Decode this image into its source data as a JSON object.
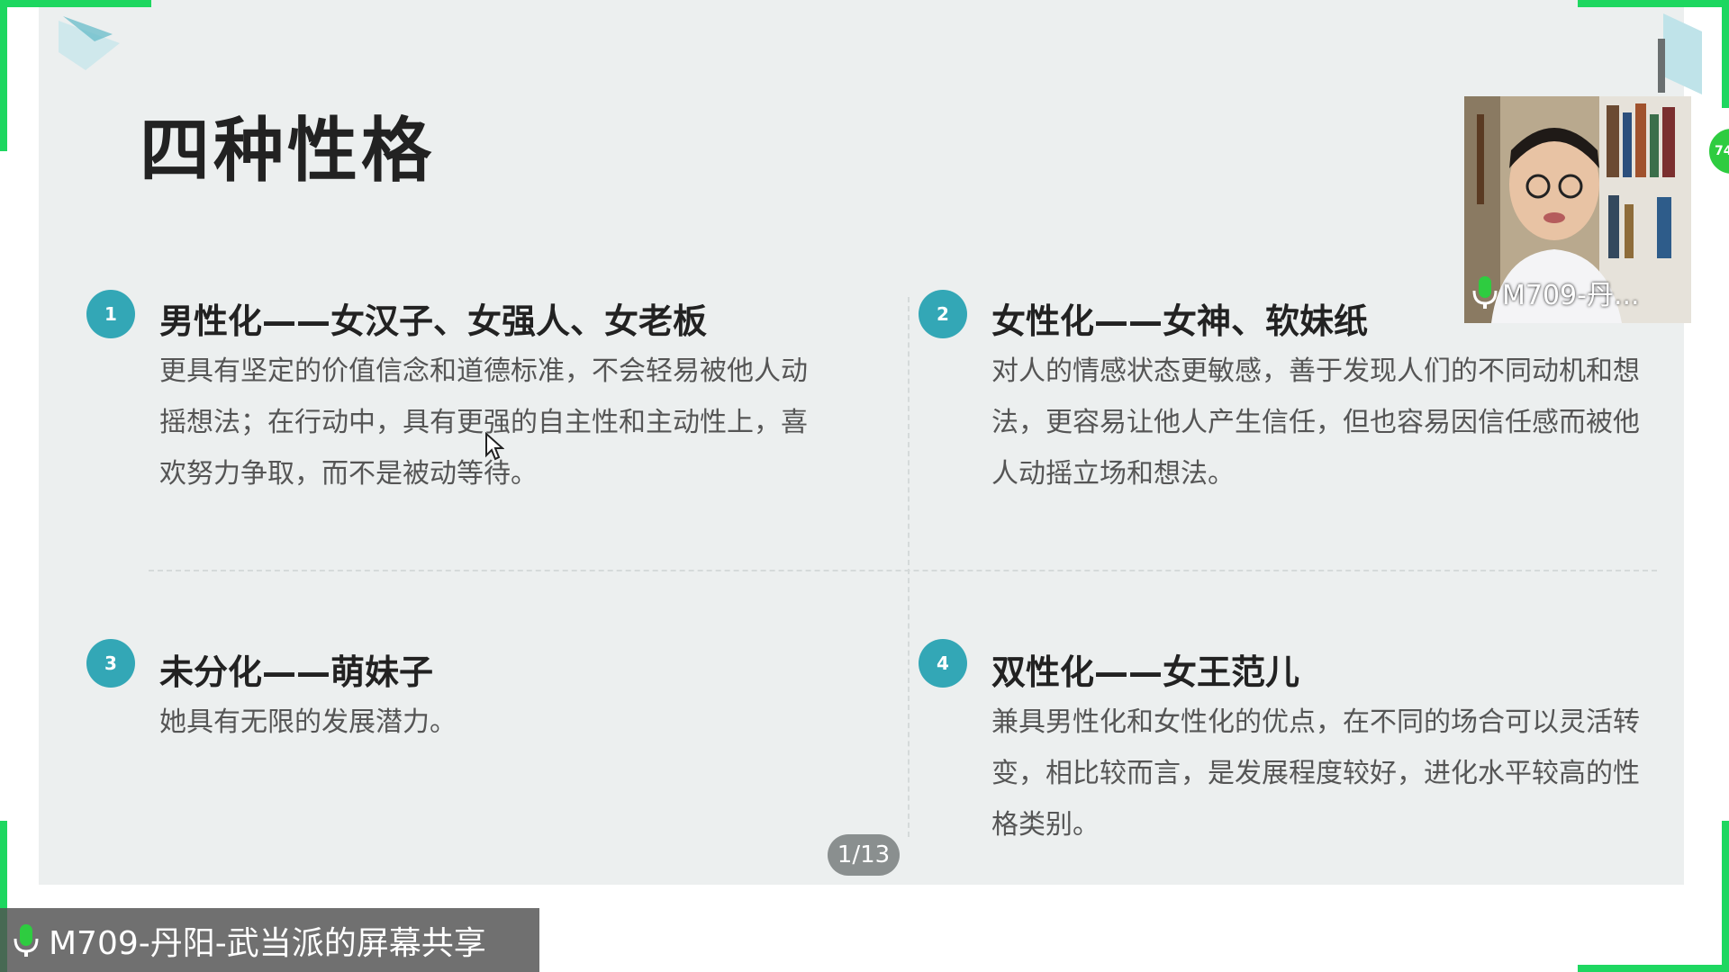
{
  "slide": {
    "title": "四种性格",
    "items": [
      {
        "number": "1",
        "title": "男性化——女汉子、女强人、女老板",
        "description": "更具有坚定的价值信念和道德标准，不会轻易被他人动摇想法；在行动中，具有更强的自主性和主动性上，喜欢努力争取，而不是被动等待。"
      },
      {
        "number": "2",
        "title": "女性化——女神、软妹纸",
        "description": "对人的情感状态更敏感，善于发现人们的不同动机和想法，更容易让他人产生信任，但也容易因信任感而被他人动摇立场和想法。"
      },
      {
        "number": "3",
        "title": "未分化——萌妹子",
        "description": "她具有无限的发展潜力。"
      },
      {
        "number": "4",
        "title": "双性化——女王范儿",
        "description": "兼具男性化和女性化的优点，在不同的场合可以灵活转变，相比较而言，是发展程度较好，进化水平较高的性格类别。"
      }
    ]
  },
  "webcam": {
    "name": "M709-丹..."
  },
  "edge_badge": {
    "label": "74"
  },
  "pager": {
    "label": "1/13"
  },
  "share_bar": {
    "label": "M709-丹阳-武当派的屏幕共享"
  },
  "colors": {
    "accent": "#33a7b6",
    "green": "#1ed760",
    "slide_bg": "#ecefef"
  }
}
